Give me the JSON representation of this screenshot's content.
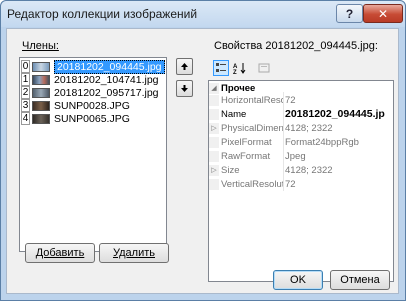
{
  "window": {
    "title": "Редактор коллекции изображений",
    "help_label": "?",
    "close_label": "✕"
  },
  "members": {
    "label": "Члены:",
    "items": [
      {
        "index": "0",
        "name": "20181202_094445.jpg",
        "selected": true
      },
      {
        "index": "1",
        "name": "20181202_104741.jpg",
        "selected": false
      },
      {
        "index": "2",
        "name": "20181202_095717.jpg",
        "selected": false
      },
      {
        "index": "3",
        "name": "SUNP0028.JPG",
        "selected": false
      },
      {
        "index": "4",
        "name": "SUNP0065.JPG",
        "selected": false
      }
    ],
    "add_label": "Добавить",
    "delete_label": "Удалить"
  },
  "properties": {
    "label": "Свойства 20181202_094445.jpg:",
    "category": "Прочее",
    "rows": [
      {
        "name": "HorizontalResolu",
        "value": "72"
      },
      {
        "name": "Name",
        "value": "20181202_094445.jp"
      },
      {
        "name": "PhysicalDimensic",
        "value": "4128; 2322"
      },
      {
        "name": "PixelFormat",
        "value": "Format24bppRgb"
      },
      {
        "name": "RawFormat",
        "value": "Jpeg"
      },
      {
        "name": "Size",
        "value": "4128; 2322"
      },
      {
        "name": "VerticalResolutio",
        "value": "72"
      }
    ]
  },
  "footer": {
    "ok_label": "OK",
    "cancel_label": "Отмена"
  },
  "colors": {
    "selection": "#3399ff",
    "close_button": "#c74b35"
  }
}
